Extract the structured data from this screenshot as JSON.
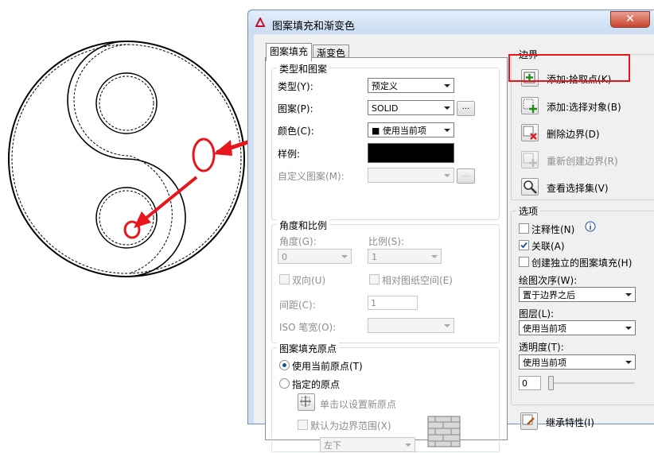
{
  "window": {
    "title": "图案填充和渐变色",
    "close_glyph": "✕"
  },
  "tabs": [
    {
      "label": "图案填充"
    },
    {
      "label": "渐变色"
    }
  ],
  "type_and_pattern": {
    "title": "类型和图案",
    "type_label": "类型(Y):",
    "type_value": "预定义",
    "pattern_label": "图案(P):",
    "pattern_value": "SOLID",
    "color_label": "颜色(C):",
    "color_value": "■ 使用当前项",
    "swatch_label": "样例:",
    "swatch_color": "#000000",
    "custom_label": "自定义图案(M):",
    "ellipsis": "..."
  },
  "angle_scale": {
    "title": "角度和比例",
    "angle_label": "角度(G):",
    "angle_value": "0",
    "scale_label": "比例(S):",
    "scale_value": "1",
    "double_label": "双向(U)",
    "relative_label": "相对图纸空间(E)",
    "spacing_label": "间距(C):",
    "spacing_value": "1",
    "iso_label": "ISO 笔宽(O):"
  },
  "origin": {
    "title": "图案填充原点",
    "use_current_label": "使用当前原点(T)",
    "specified_label": "指定的原点",
    "click_set_label": "单击以设置新原点",
    "default_extent_label": "默认为边界范围(X)",
    "position_value": "左下"
  },
  "boundaries": {
    "title": "边界",
    "add_pick_label": "添加:拾取点(K)",
    "add_select_label": "添加:选择对象(B)",
    "remove_label": "删除边界(D)",
    "recreate_label": "重新创建边界(R)",
    "view_label": "查看选择集(V)"
  },
  "options": {
    "title": "选项",
    "annotative_label": "注释性(N)",
    "associative_label": "关联(A)",
    "separate_label": "创建独立的图案填充(H)",
    "draw_order_label": "绘图次序(W):",
    "draw_order_value": "置于边界之后",
    "layer_label": "图层(L):",
    "layer_value": "使用当前项",
    "transparency_label": "透明度(T):",
    "transparency_value": "使用当前项",
    "transparency_number": "0",
    "inherit_label": "继承特性(I)"
  },
  "colors": {
    "annotation_red": "#e8161b",
    "accent_blue": "#1b4fa0"
  }
}
